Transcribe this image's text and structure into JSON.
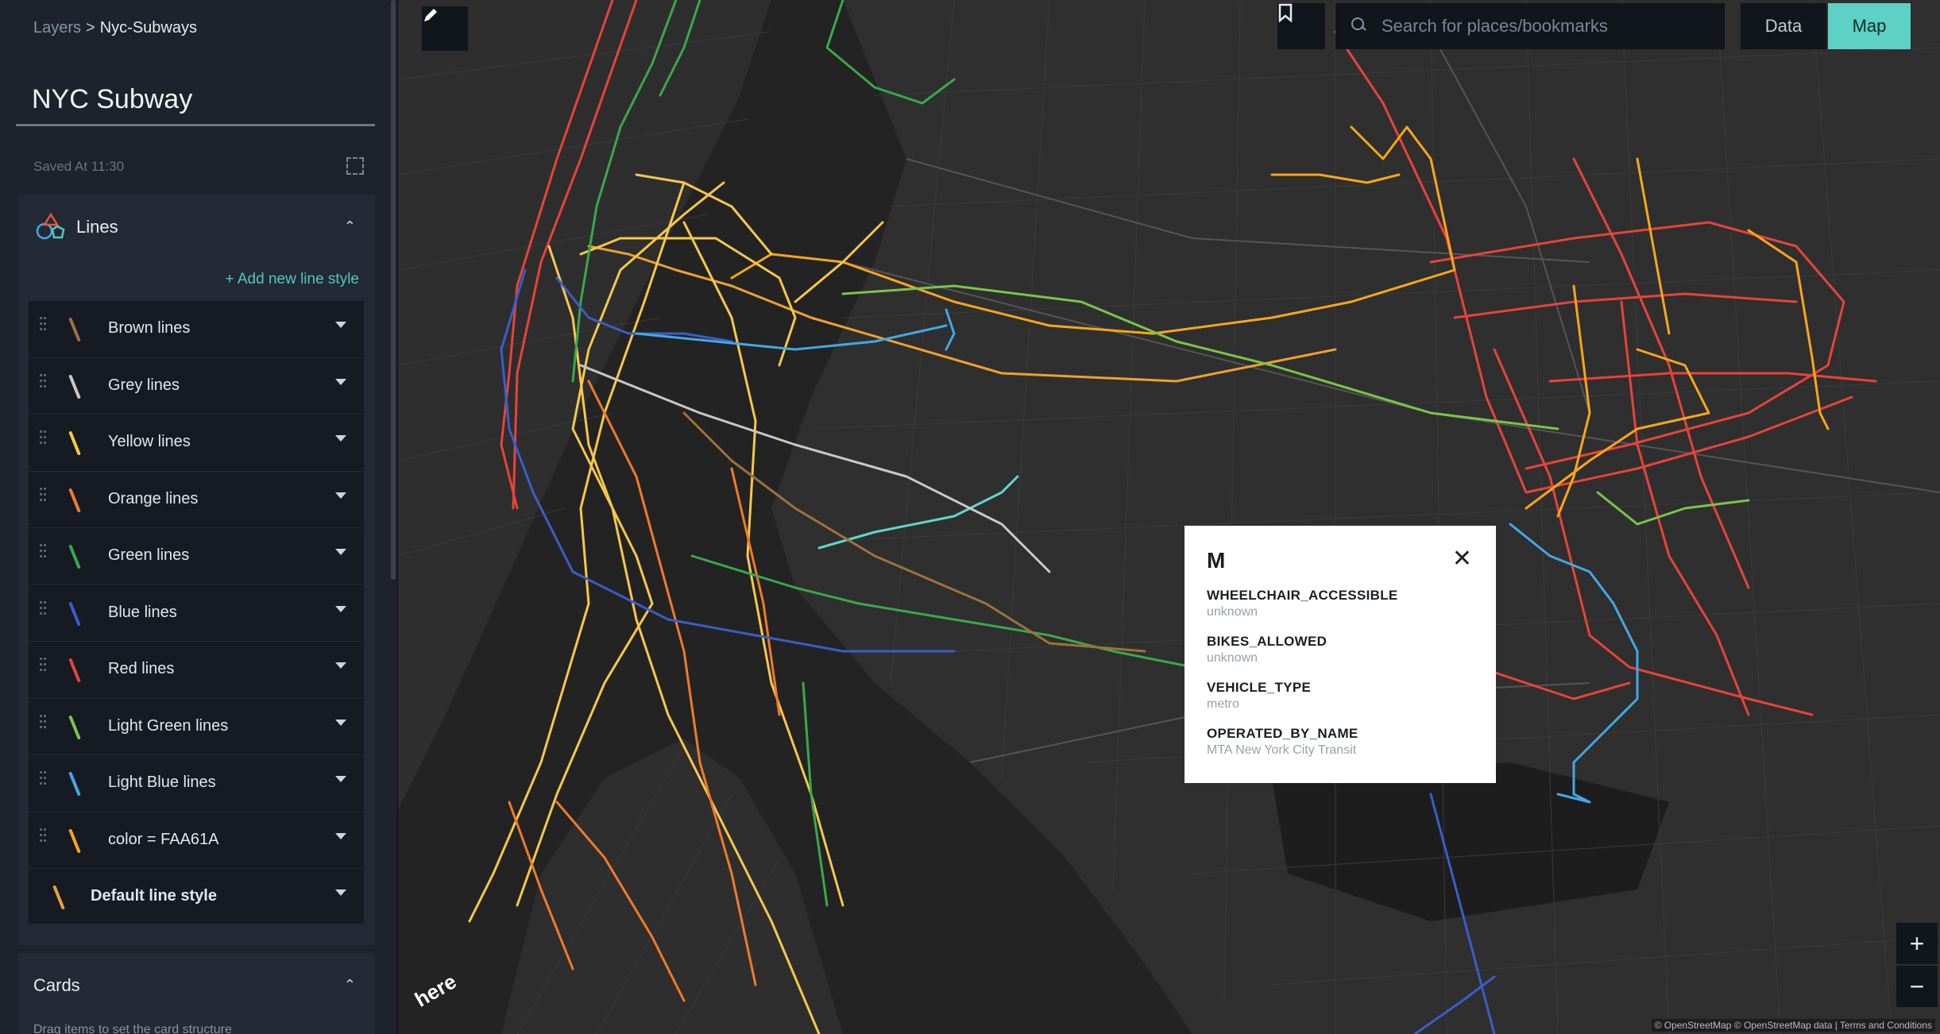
{
  "breadcrumb": {
    "parent": "Layers",
    "separator": ">",
    "current": "Nyc-Subways"
  },
  "layer_title": "NYC Subway",
  "saved_text": "Saved At 11:30",
  "lines_panel": {
    "title": "Lines",
    "add_style_label": "+ Add new line style",
    "styles": [
      {
        "name": "Brown lines",
        "color": "#a0703c"
      },
      {
        "name": "Grey lines",
        "color": "#c8c8c8"
      },
      {
        "name": "Yellow lines",
        "color": "#f5c84a"
      },
      {
        "name": "Orange lines",
        "color": "#f07a2a"
      },
      {
        "name": "Green lines",
        "color": "#3aa84a"
      },
      {
        "name": "Blue lines",
        "color": "#3a5ec8"
      },
      {
        "name": "Red lines",
        "color": "#e8433a"
      },
      {
        "name": "Light Green lines",
        "color": "#7ac54a"
      },
      {
        "name": "Light Blue lines",
        "color": "#42a8e8"
      },
      {
        "name": "color = FAA61A",
        "color": "#faa61a"
      },
      {
        "name": "Default line style",
        "color": "#e8a33a"
      }
    ]
  },
  "cards_panel": {
    "title": "Cards",
    "hint": "Drag items to set the card structure"
  },
  "map": {
    "search_placeholder": "Search for places/bookmarks",
    "tab_data": "Data",
    "tab_map": "Map",
    "zoom_in": "+",
    "zoom_out": "−",
    "logo": "here",
    "attribution": "© OpenStreetMap © OpenStreetMap data | Terms and Conditions",
    "colors": {
      "accent": "#5cd1c4",
      "background": "#232323",
      "land": "#2e2e2e",
      "water": "#1b1b1b"
    }
  },
  "popup": {
    "title": "M",
    "properties": [
      {
        "key": "WHEELCHAIR_ACCESSIBLE",
        "value": "unknown"
      },
      {
        "key": "BIKES_ALLOWED",
        "value": "unknown"
      },
      {
        "key": "VEHICLE_TYPE",
        "value": "metro"
      },
      {
        "key": "OPERATED_BY_NAME",
        "value": "MTA New York City Transit"
      }
    ]
  }
}
